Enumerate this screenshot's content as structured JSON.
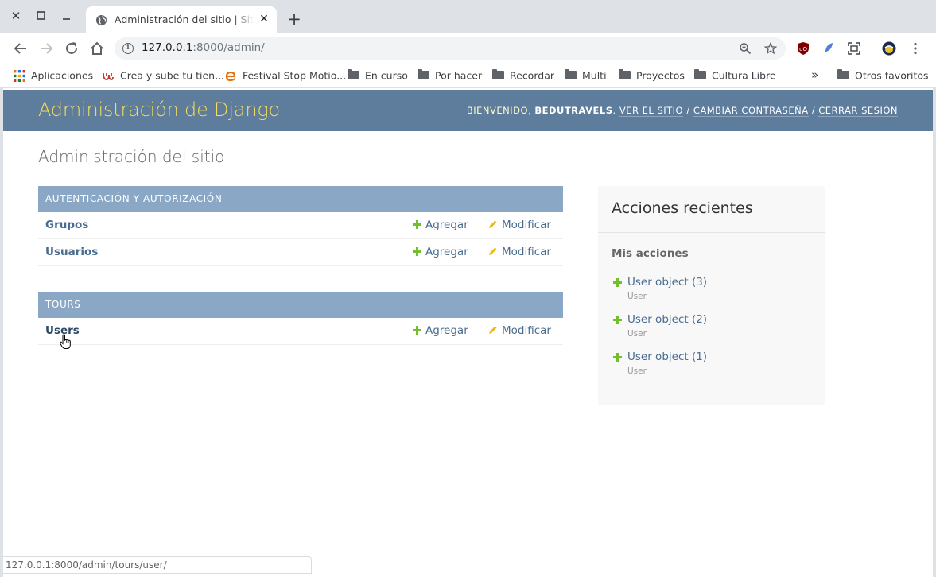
{
  "browser": {
    "tab_title": "Administración del sitio | Sitio de administración de Django",
    "url_host": "127.0.0.1",
    "url_rest": ":8000/admin/",
    "status_url": "127.0.0.1:8000/admin/tours/user/",
    "bookmarks": [
      {
        "label": "Aplicaciones",
        "icon": "apps-grid-icon"
      },
      {
        "label": "Crea y sube tu tien...",
        "icon": "u-logo-icon"
      },
      {
        "label": "Festival Stop Motio...",
        "icon": "e-logo-icon"
      },
      {
        "label": "En curso",
        "icon": "folder-icon"
      },
      {
        "label": "Por hacer",
        "icon": "folder-icon"
      },
      {
        "label": "Recordar",
        "icon": "folder-icon"
      },
      {
        "label": "Multi",
        "icon": "folder-icon"
      },
      {
        "label": "Proyectos",
        "icon": "folder-icon"
      },
      {
        "label": "Cultura Libre",
        "icon": "folder-icon"
      }
    ],
    "overflow_label": "»",
    "other_bookmarks": "Otros favoritos"
  },
  "header": {
    "branding": "Administración de Django",
    "welcome": "BIENVENIDO,",
    "username": "BEDUTRAVELS",
    "view_site": "VER EL SITIO",
    "change_password": "CAMBIAR CONTRASEÑA",
    "logout": "CERRAR SESIÓN",
    "separator": "/"
  },
  "content": {
    "title": "Administración del sitio",
    "modules": [
      {
        "caption": "AUTENTICACIÓN Y AUTORIZACIÓN",
        "rows": [
          {
            "name": "Grupos",
            "add": "Agregar",
            "change": "Modificar"
          },
          {
            "name": "Usuarios",
            "add": "Agregar",
            "change": "Modificar"
          }
        ]
      },
      {
        "caption": "TOURS",
        "rows": [
          {
            "name": "Users",
            "add": "Agregar",
            "change": "Modificar"
          }
        ]
      }
    ]
  },
  "recent_actions": {
    "title": "Acciones recientes",
    "subtitle": "Mis acciones",
    "items": [
      {
        "label": "User object (3)",
        "type": "User"
      },
      {
        "label": "User object (2)",
        "type": "User"
      },
      {
        "label": "User object (1)",
        "type": "User"
      }
    ]
  },
  "colors": {
    "header_bg": "#5e7c9c",
    "branding": "#f5dd5d",
    "caption_bg": "#8aa8c6",
    "link": "#4a6c8f",
    "add_icon": "#70bf2b",
    "change_icon": "#efb80b"
  }
}
